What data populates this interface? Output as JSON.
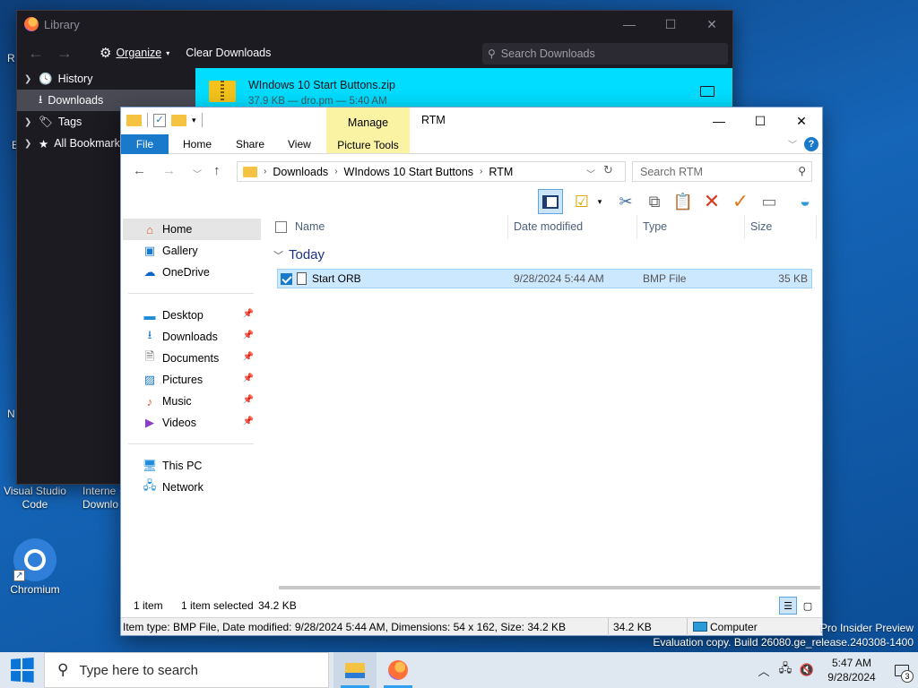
{
  "desktop": {
    "icons": [
      {
        "label_line1": "Visual Studio",
        "label_line2": "Code"
      },
      {
        "label_line1": "Interne",
        "label_line2": "Downlo"
      },
      {
        "label": "Chromium"
      }
    ],
    "edge_fragments": [
      "R",
      "E",
      "N"
    ]
  },
  "library": {
    "title": "Library",
    "toolbar": {
      "organize": "Organize",
      "clear_downloads": "Clear Downloads"
    },
    "search_placeholder": "Search Downloads",
    "sidebar": [
      {
        "label": "History",
        "selected": false
      },
      {
        "label": "Downloads",
        "selected": true
      },
      {
        "label": "Tags",
        "selected": false
      },
      {
        "label": "All Bookmarks",
        "selected": false
      }
    ],
    "download": {
      "name": "WIndows 10 Start Buttons.zip",
      "meta": "37.9 KB — dro.pm — 5:40 AM"
    }
  },
  "explorer": {
    "title": "RTM",
    "manage_tab": "Manage",
    "ribbon_tabs": {
      "file": "File",
      "home": "Home",
      "share": "Share",
      "view": "View",
      "picture_tools": "Picture Tools"
    },
    "breadcrumb": [
      "Downloads",
      "WIndows 10 Start Buttons",
      "RTM"
    ],
    "search_placeholder": "Search RTM",
    "nav": {
      "home": "Home",
      "gallery": "Gallery",
      "onedrive": "OneDrive",
      "desktop": "Desktop",
      "downloads": "Downloads",
      "documents": "Documents",
      "pictures": "Pictures",
      "music": "Music",
      "videos": "Videos",
      "this_pc": "This PC",
      "network": "Network"
    },
    "columns": {
      "name": "Name",
      "date": "Date modified",
      "type": "Type",
      "size": "Size"
    },
    "group": "Today",
    "files": [
      {
        "name": "Start ORB",
        "date": "9/28/2024 5:44 AM",
        "type": "BMP File",
        "size": "35 KB",
        "selected": true
      }
    ],
    "status": {
      "count": "1 item",
      "selected": "1 item selected",
      "sel_size": "34.2 KB"
    },
    "details": {
      "info": "Item type: BMP File, Date modified: 9/28/2024 5:44 AM, Dimensions: 54 x 162, Size: 34.2 KB",
      "size": "34.2 KB",
      "location": "Computer"
    }
  },
  "watermark": {
    "line1": "Pro Insider Preview",
    "line2": "Evaluation copy. Build 26080.ge_release.240308-1400"
  },
  "taskbar": {
    "search_placeholder": "Type here to search",
    "time": "5:47 AM",
    "date": "9/28/2024",
    "notification_count": "3"
  },
  "colors": {
    "accent": "#1979ca",
    "library_bg": "#1c1b22",
    "download_highlight": "#00ddff",
    "manage_tab": "#faf3a3",
    "selection": "#cce8ff"
  }
}
